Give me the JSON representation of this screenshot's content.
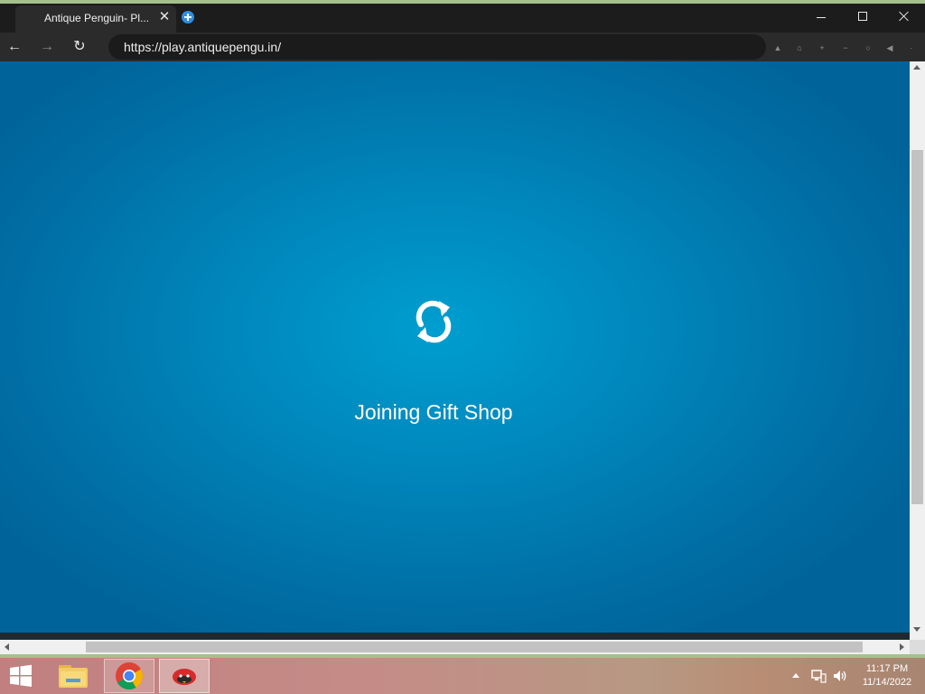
{
  "browser": {
    "tab": {
      "title": "Antique Penguin- Pl...",
      "close_glyph": "✕"
    },
    "new_tab_icon": "plus-circle-icon",
    "window_controls": [
      "minimize-icon",
      "maximize-icon",
      "close-icon"
    ],
    "nav": {
      "back_glyph": "←",
      "forward_glyph": "→",
      "reload_glyph": "↻"
    },
    "address_bar": {
      "url": "https://play.antiquepengu.in/"
    },
    "extension_icons": [
      "pin-icon",
      "home-icon",
      "plus-icon",
      "minus-icon",
      "circle-icon",
      "speaker-icon",
      "dot-icon"
    ]
  },
  "page": {
    "loading_icon": "refresh-icon",
    "loading_text": "Joining Gift Shop",
    "background_colors": {
      "center": "#009ed0",
      "edge": "#006399"
    }
  },
  "taskbar": {
    "start_icon": "windows-logo-icon",
    "apps": [
      {
        "name": "File Explorer",
        "icon": "folder-icon"
      },
      {
        "name": "Google Chrome",
        "icon": "chrome-icon"
      },
      {
        "name": "Antique Penguin",
        "icon": "penguin-game-icon"
      }
    ],
    "tray": {
      "network_icon": "network-icon",
      "volume_icon": "volume-icon",
      "time": "11:17 PM",
      "date": "11/14/2022"
    }
  }
}
